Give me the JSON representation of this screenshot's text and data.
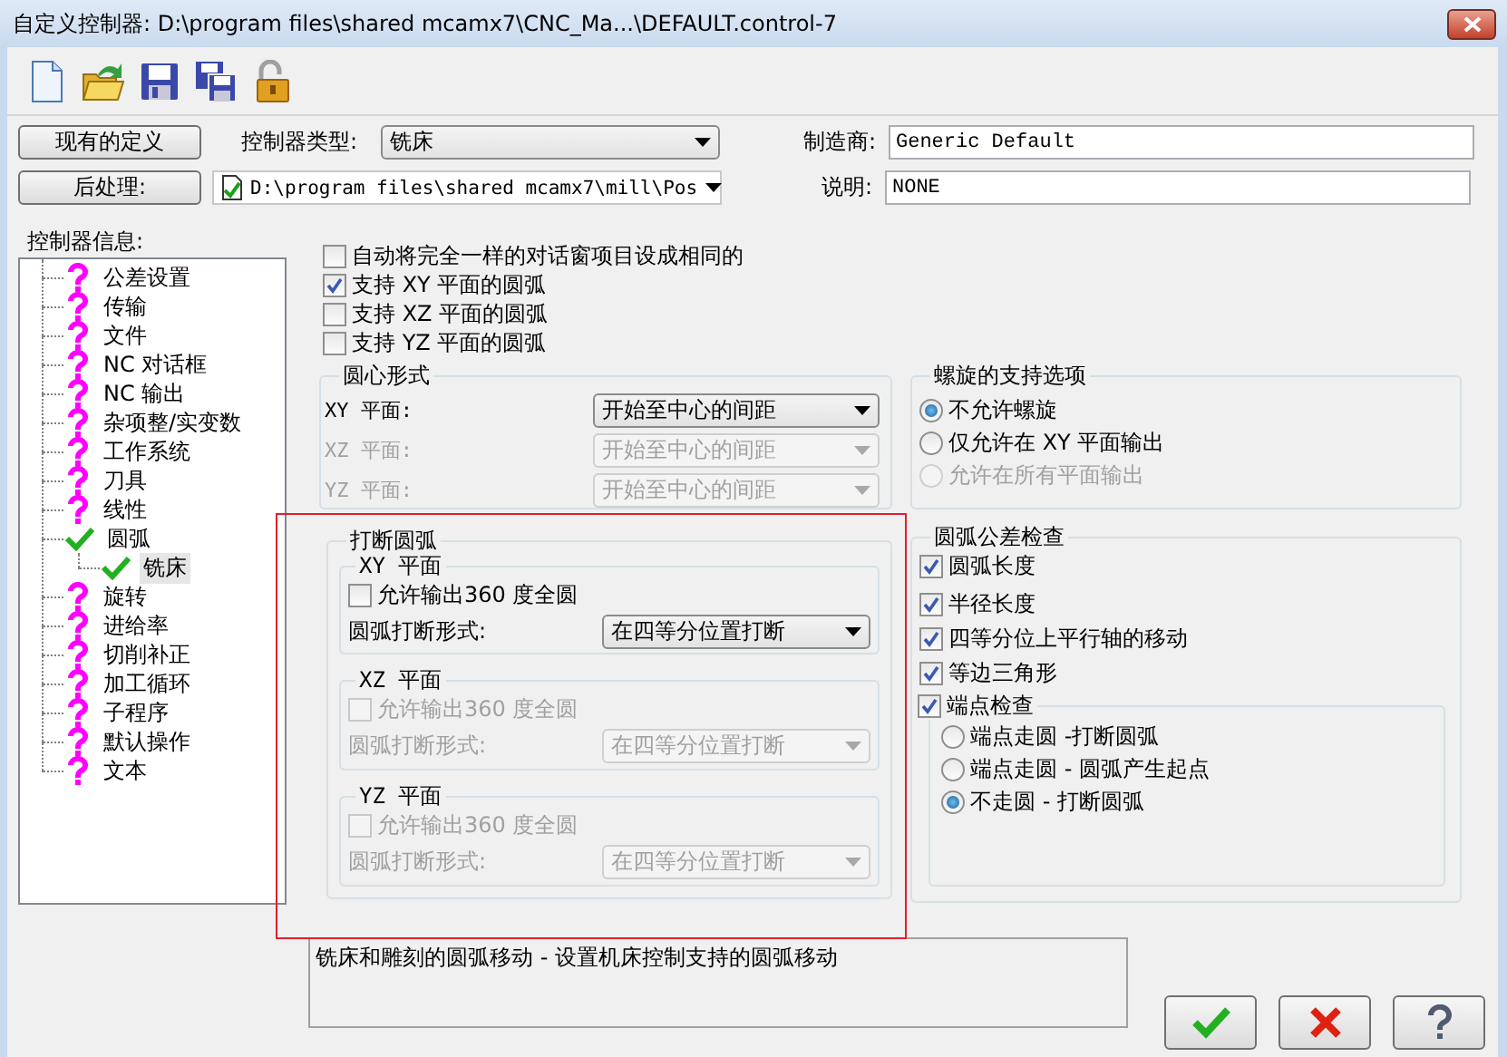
{
  "window": {
    "title": "自定义控制器: D:\\program files\\shared mcamx7\\CNC_Ma...\\DEFAULT.control-7"
  },
  "toolbar": [
    {
      "kind": "new"
    },
    {
      "kind": "open"
    },
    {
      "kind": "save"
    },
    {
      "kind": "save_all"
    },
    {
      "kind": "lock"
    }
  ],
  "definition_button": "现有的定义",
  "controller_type": {
    "label": "控制器类型:",
    "value": "铣床"
  },
  "manufacturer": {
    "label": "制造商:",
    "value": "Generic Default"
  },
  "post_button": "后处理:",
  "post_file": {
    "value": "D:\\program files\\shared mcamx7\\mill\\Pos"
  },
  "description": {
    "label": "说明:",
    "value": "NONE"
  },
  "tree": {
    "label": "控制器信息:",
    "items": [
      {
        "label": "公差设置",
        "kind": "unknown",
        "selected": false
      },
      {
        "label": "传输",
        "kind": "unknown",
        "selected": false
      },
      {
        "label": "文件",
        "kind": "unknown",
        "selected": false
      },
      {
        "label": "NC 对话框",
        "kind": "unknown",
        "selected": false
      },
      {
        "label": "NC 输出",
        "kind": "unknown",
        "selected": false
      },
      {
        "label": "杂项整/实变数",
        "kind": "unknown",
        "selected": false
      },
      {
        "label": "工作系统",
        "kind": "unknown",
        "selected": false
      },
      {
        "label": "刀具",
        "kind": "unknown",
        "selected": false
      },
      {
        "label": "线性",
        "kind": "unknown",
        "selected": false
      },
      {
        "label": "圆弧",
        "kind": "done",
        "selected": false,
        "children": [
          {
            "label": "铣床",
            "kind": "done",
            "selected": true
          }
        ]
      },
      {
        "label": "旋转",
        "kind": "unknown",
        "selected": false
      },
      {
        "label": "进给率",
        "kind": "unknown",
        "selected": false
      },
      {
        "label": "切削补正",
        "kind": "unknown",
        "selected": false
      },
      {
        "label": "加工循环",
        "kind": "unknown",
        "selected": false
      },
      {
        "label": "子程序",
        "kind": "unknown",
        "selected": false
      },
      {
        "label": "默认操作",
        "kind": "unknown",
        "selected": false
      },
      {
        "label": "文本",
        "kind": "unknown",
        "selected": false
      }
    ]
  },
  "options": [
    {
      "label": "自动将完全一样的对话窗项目设成相同的",
      "checked": false
    },
    {
      "label": "支持 XY 平面的圆弧",
      "checked": true
    },
    {
      "label": "支持 XZ 平面的圆弧",
      "checked": false
    },
    {
      "label": "支持 YZ 平面的圆弧",
      "checked": false
    }
  ],
  "arc_center": {
    "title": "圆心形式",
    "rows": [
      {
        "label": "XY 平面:",
        "value": "开始至中心的间距",
        "disabled": false
      },
      {
        "label": "XZ 平面:",
        "value": "开始至中心的间距",
        "disabled": true
      },
      {
        "label": "YZ 平面:",
        "value": "开始至中心的间距",
        "disabled": true
      }
    ]
  },
  "helix": {
    "title": "螺旋的支持选项",
    "options": [
      {
        "label": "不允许螺旋",
        "selected": true,
        "disabled": false
      },
      {
        "label": "仅允许在 XY 平面输出",
        "selected": false,
        "disabled": false
      },
      {
        "label": "允许在所有平面输出",
        "selected": false,
        "disabled": true
      }
    ]
  },
  "break_arc": {
    "title": "打断圆弧",
    "planes": [
      {
        "title": "XY 平面",
        "full_circle": {
          "label": "允许输出360 度全圆",
          "checked": false
        },
        "break_label": "圆弧打断形式:",
        "break_value": "在四等分位置打断",
        "disabled": false
      },
      {
        "title": "XZ 平面",
        "full_circle": {
          "label": "允许输出360 度全圆",
          "checked": false
        },
        "break_label": "圆弧打断形式:",
        "break_value": "在四等分位置打断",
        "disabled": true
      },
      {
        "title": "YZ 平面",
        "full_circle": {
          "label": "允许输出360 度全圆",
          "checked": false
        },
        "break_label": "圆弧打断形式:",
        "break_value": "在四等分位置打断",
        "disabled": true
      }
    ]
  },
  "tolerance": {
    "title": "圆弧公差检查",
    "checks": [
      {
        "label": "圆弧长度",
        "checked": true
      },
      {
        "label": "半径长度",
        "checked": true
      },
      {
        "label": "四等分位上平行轴的移动",
        "checked": true
      },
      {
        "label": "等边三角形",
        "checked": true
      }
    ],
    "endpoint": {
      "label": "端点检查",
      "checked": true,
      "options": [
        {
          "label": "端点走圆 -打断圆弧",
          "selected": false
        },
        {
          "label": "端点走圆 - 圆弧产生起点",
          "selected": false
        },
        {
          "label": "不走圆 - 打断圆弧",
          "selected": true
        }
      ]
    }
  },
  "status_text": "铣床和雕刻的圆弧移动 - 设置机床控制支持的圆弧移动",
  "dialog_buttons": [
    {
      "kind": "ok"
    },
    {
      "kind": "cancel"
    },
    {
      "kind": "help"
    }
  ]
}
